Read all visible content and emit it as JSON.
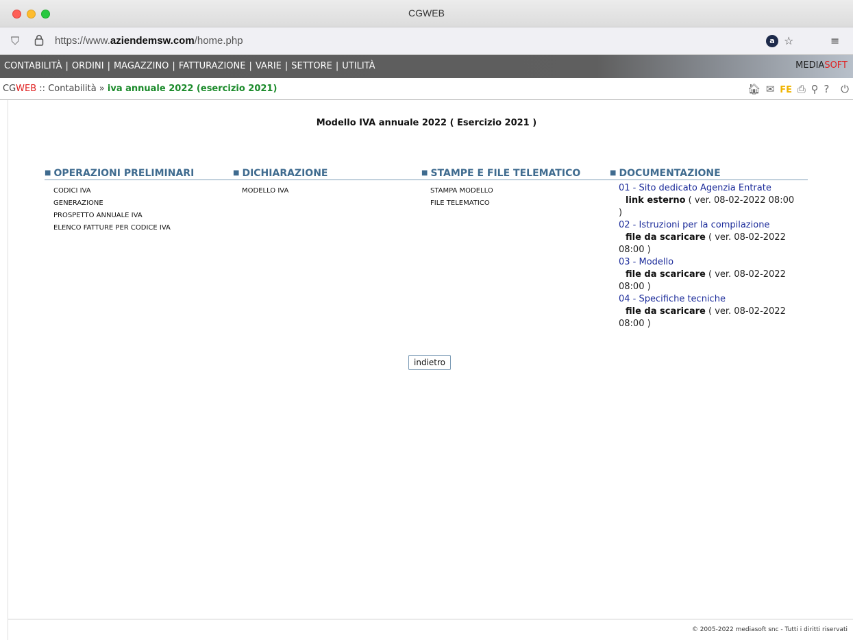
{
  "window": {
    "title": "CGWEB"
  },
  "browser": {
    "url_prefix": "https://www.",
    "url_domain": "aziendemsw.com",
    "url_path": "/home.php"
  },
  "menu": {
    "items": [
      "CONTABILITÀ",
      "ORDINI",
      "MAGAZZINO",
      "FATTURAZIONE",
      "VARIE",
      "SETTORE",
      "UTILITÀ"
    ],
    "separator": "|",
    "brand_main": "MEDIA",
    "brand_accent": "SOFT"
  },
  "breadcrumb": {
    "app_a": "CG",
    "app_b": "WEB",
    "sep1": " :: ",
    "section": "Contabilità",
    "sep2": " » ",
    "current": "iva annuale 2022 (esercizio 2021)"
  },
  "tools": {
    "fe": "FE"
  },
  "page": {
    "title": "Modello IVA annuale 2022 ( Esercizio 2021 )"
  },
  "columns": [
    {
      "title": "OPERAZIONI PRELIMINARI",
      "items": [
        "CODICI IVA",
        "GENERAZIONE",
        "PROSPETTO ANNUALE IVA",
        "ELENCO FATTURE PER CODICE IVA"
      ]
    },
    {
      "title": "DICHIARAZIONE",
      "items": [
        "MODELLO IVA"
      ]
    },
    {
      "title": "STAMPE E FILE TELEMATICO",
      "items": [
        "STAMPA MODELLO",
        "FILE TELEMATICO"
      ]
    },
    {
      "title": "DOCUMENTAZIONE"
    }
  ],
  "docs": [
    {
      "title": "01 - Sito dedicato Agenzia Entrate",
      "kind": "link esterno",
      "ver": "( ver. 08-02-2022 08:00",
      "ver_end": ")"
    },
    {
      "title": "02 - Istruzioni per la compilazione",
      "kind": "file da scaricare",
      "ver": "( ver. 08-02-2022",
      "ver_end": "08:00 )"
    },
    {
      "title": "03 - Modello",
      "kind": "file da scaricare",
      "ver": "( ver. 08-02-2022",
      "ver_end": "08:00 )"
    },
    {
      "title": "04 - Specifiche tecniche",
      "kind": "file da scaricare",
      "ver": "( ver. 08-02-2022",
      "ver_end": "08:00 )"
    }
  ],
  "back_button": "indietro",
  "footer": "© 2005-2022 mediasoft snc - Tutti i diritti riservati",
  "colors": {
    "accent_green": "#1a8a2a",
    "accent_red": "#e02020",
    "section_blue": "#3f6b8f",
    "link_blue": "#1b2b9a"
  }
}
